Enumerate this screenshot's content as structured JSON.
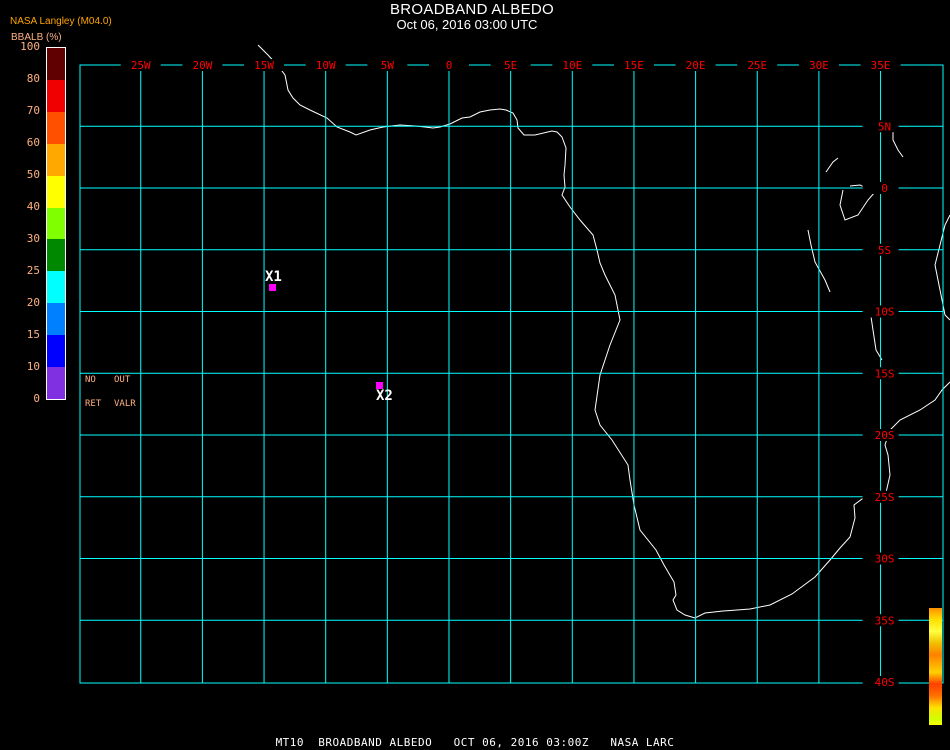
{
  "header": {
    "title": "BROADBAND ALBEDO",
    "subtitle": "Oct 06, 2016 03:00 UTC",
    "source": "NASA Langley (M04.0)"
  },
  "colorbar": {
    "title": "BBALB (%)",
    "labels": [
      "100",
      "80",
      "70",
      "60",
      "50",
      "40",
      "30",
      "25",
      "20",
      "15",
      "10",
      "0"
    ],
    "colors": [
      "#600000",
      "#f00000",
      "#ff5000",
      "#ffa800",
      "#ffff00",
      "#80ff00",
      "#008800",
      "#00ffff",
      "#0080ff",
      "#0000ff",
      "#8030e0"
    ]
  },
  "legend_notes": {
    "no": "NO",
    "out": "OUT",
    "ret": "RET",
    "valr": "VALR"
  },
  "grid": {
    "lon_labels": [
      "25W",
      "20W",
      "15W",
      "10W",
      "5W",
      "0",
      "5E",
      "10E",
      "15E",
      "20E",
      "25E",
      "30E",
      "35E"
    ],
    "lon_values": [
      -25,
      -20,
      -15,
      -10,
      -5,
      0,
      5,
      10,
      15,
      20,
      25,
      30,
      35
    ],
    "lat_labels": [
      "5N",
      "0",
      "5S",
      "10S",
      "15S",
      "20S",
      "25S",
      "30S",
      "35S",
      "40S"
    ],
    "lat_values": [
      5,
      0,
      -5,
      -10,
      -15,
      -20,
      -25,
      -30,
      -35,
      -40
    ],
    "line_color": "#00ffff",
    "label_color": "#ff0000"
  },
  "markers": [
    {
      "label": "X1",
      "lon": -14.4,
      "lat": -8.1
    },
    {
      "label": "X2",
      "lon": -5.6,
      "lat": -16.0
    }
  ],
  "footer": "MT10  BROADBAND ALBEDO   OCT 06, 2016 03:00Z   NASA LARC"
}
